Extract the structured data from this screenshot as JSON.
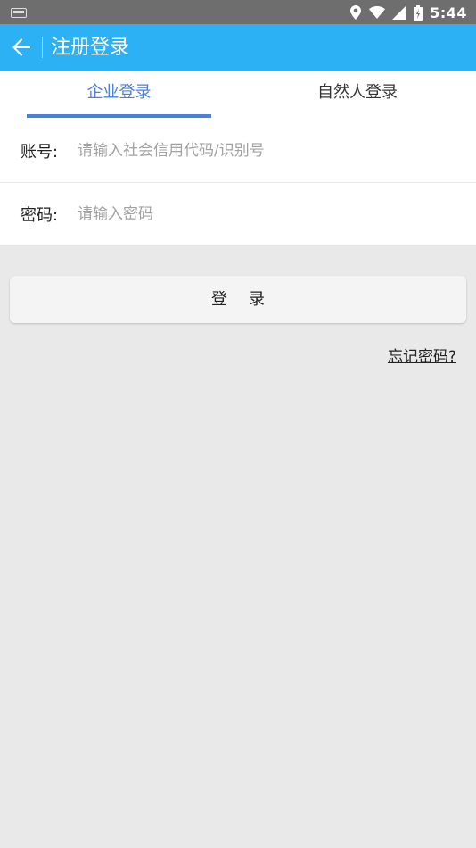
{
  "status_bar": {
    "time": "5:44"
  },
  "app_bar": {
    "title": "注册登录"
  },
  "tabs": [
    {
      "label": "企业登录",
      "active": true
    },
    {
      "label": "自然人登录",
      "active": false
    }
  ],
  "form": {
    "account": {
      "label": "账号:",
      "value": "",
      "placeholder": "请输入社会信用代码/识别号"
    },
    "password": {
      "label": "密码:",
      "value": "",
      "placeholder": "请输入密码"
    }
  },
  "login_button": {
    "label": "登录"
  },
  "forgot_link": {
    "label": "忘记密码?"
  },
  "colors": {
    "app_bar": "#2cb1f5",
    "accent": "#4a7fe0",
    "status_bar": "#6e6e6e",
    "background": "#e9e9e9"
  }
}
